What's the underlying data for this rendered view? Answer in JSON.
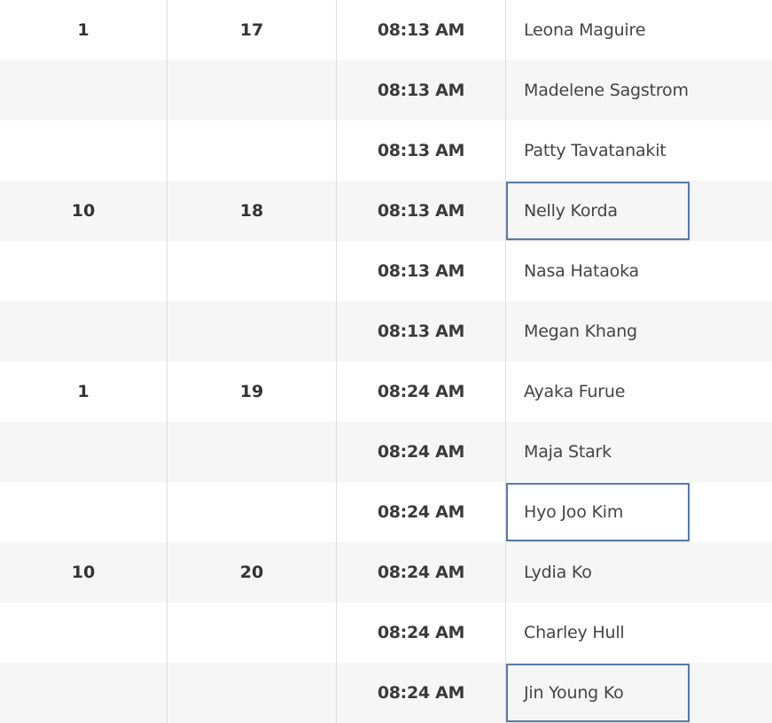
{
  "rows": [
    {
      "tee": "1",
      "group": "17",
      "time": "08:13 AM",
      "player": "Leona Maguire"
    },
    {
      "tee": "",
      "group": "",
      "time": "08:13 AM",
      "player": "Madelene Sagstrom"
    },
    {
      "tee": "",
      "group": "",
      "time": "08:13 AM",
      "player": "Patty Tavatanakit"
    },
    {
      "tee": "10",
      "group": "18",
      "time": "08:13 AM",
      "player": "Nelly Korda"
    },
    {
      "tee": "",
      "group": "",
      "time": "08:13 AM",
      "player": "Nasa Hataoka"
    },
    {
      "tee": "",
      "group": "",
      "time": "08:13 AM",
      "player": "Megan Khang"
    },
    {
      "tee": "1",
      "group": "19",
      "time": "08:24 AM",
      "player": "Ayaka Furue"
    },
    {
      "tee": "",
      "group": "",
      "time": "08:24 AM",
      "player": "Maja Stark"
    },
    {
      "tee": "",
      "group": "",
      "time": "08:24 AM",
      "player": "Hyo Joo Kim"
    },
    {
      "tee": "10",
      "group": "20",
      "time": "08:24 AM",
      "player": "Lydia Ko"
    },
    {
      "tee": "",
      "group": "",
      "time": "08:24 AM",
      "player": "Charley Hull"
    },
    {
      "tee": "",
      "group": "",
      "time": "08:24 AM",
      "player": "Jin Young Ko"
    }
  ],
  "highlighted_players": [
    "Nelly Korda",
    "Hyo Joo Kim",
    "Jin Young Ko"
  ],
  "colors": {
    "row_alt_background": "#f6f6f6",
    "divider": "#dddddd",
    "highlight_border": "#5a7aa8",
    "text": "#333333"
  }
}
